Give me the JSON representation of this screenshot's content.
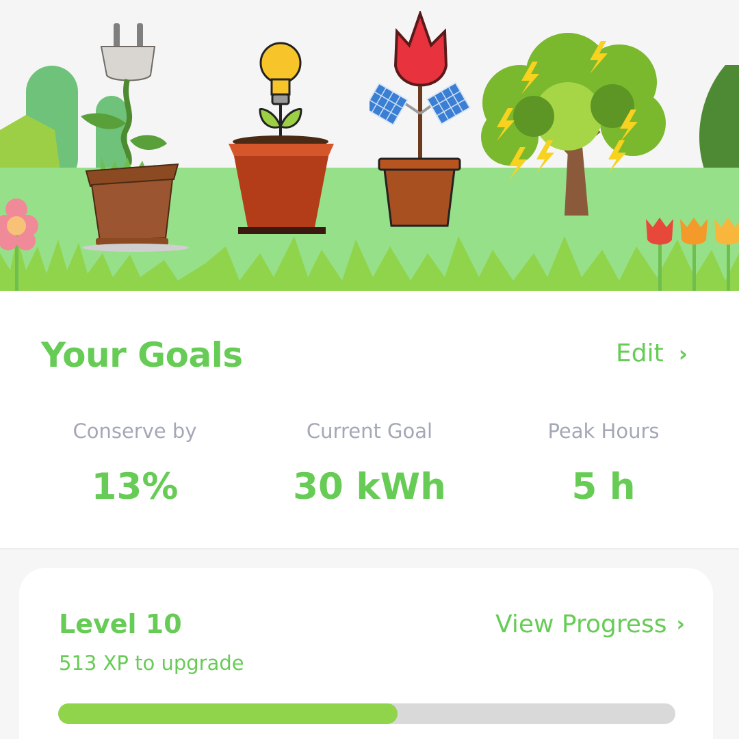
{
  "colors": {
    "accent": "#66cc55",
    "progress_fill": "#8fd44b",
    "progress_track": "#d9d9d9",
    "muted_label": "#a3a8b6"
  },
  "banner": {
    "illustrations": [
      "plug-plant-icon",
      "lightbulb-sprout-icon",
      "tulip-solar-panel-icon",
      "lightning-tree-icon"
    ]
  },
  "goals": {
    "title": "Your Goals",
    "edit_label": "Edit",
    "edit_icon": "chevron-right-icon",
    "stats": [
      {
        "label": "Conserve by",
        "value": "13%"
      },
      {
        "label": "Current Goal",
        "value": "30 kWh"
      },
      {
        "label": "Peak Hours",
        "value": "5 h"
      }
    ]
  },
  "level": {
    "title": "Level 10",
    "xp_text": "513 XP to upgrade",
    "view_progress_label": "View Progress",
    "view_progress_icon": "chevron-right-icon",
    "progress_fraction": 0.55
  }
}
